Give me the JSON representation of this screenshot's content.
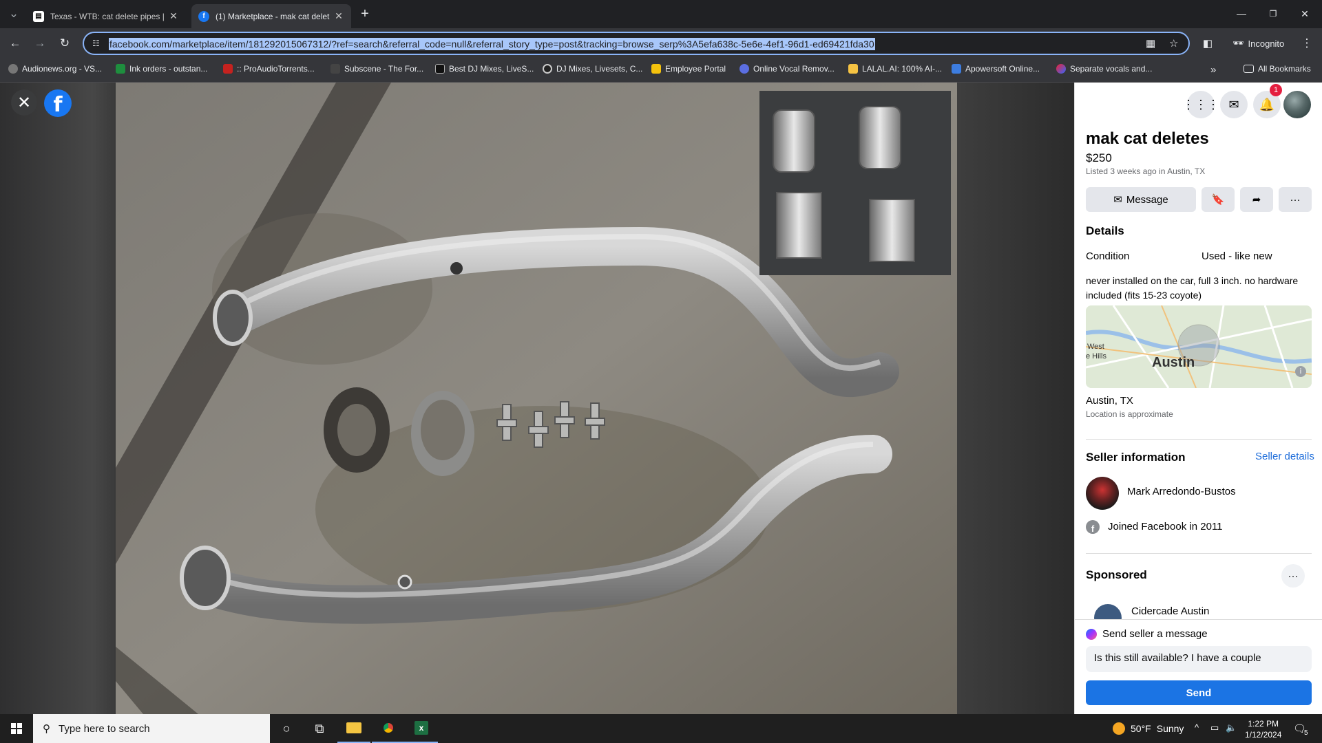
{
  "browser": {
    "tabs": [
      {
        "title": "Texas - WTB: cat delete pipes |",
        "favicon": "site-favicon-icon",
        "active": false
      },
      {
        "title": "(1) Marketplace - mak cat delet",
        "favicon": "facebook-icon",
        "active": true
      }
    ],
    "new_tab": "+",
    "url": "facebook.com/marketplace/item/181292015067312/?ref=search&referral_code=null&referral_story_type=post&tracking=browse_serp%3A5efa638c-5e6e-4ef1-96d1-ed69421fda30",
    "profile_label": "Incognito",
    "bookmarks": [
      "Audionews.org - VS...",
      "Ink orders - outstan...",
      ":: ProAudioTorrents...",
      "Subscene - The For...",
      "Best DJ Mixes, LiveS...",
      "DJ Mixes, Livesets, C...",
      "Employee Portal",
      "Online Vocal Remov...",
      "LALAL.AI: 100% AI-...",
      "Apowersoft Online...",
      "Separate vocals and..."
    ],
    "bookmarks_more": "»",
    "all_bookmarks": "All Bookmarks"
  },
  "listing": {
    "title": "mak cat deletes",
    "price": "$250",
    "listed": "Listed 3 weeks ago in Austin, TX",
    "message_button": "Message",
    "details_heading": "Details",
    "condition_label": "Condition",
    "condition_value": "Used - like new",
    "description": "never installed on the car, full 3 inch. no hardware included (fits 15-23 coyote)",
    "map": {
      "west_label": "West",
      "hills_label": "e Hills",
      "city_label": "Austin",
      "info": "i"
    },
    "location": "Austin, TX",
    "location_note": "Location is approximate"
  },
  "seller": {
    "heading": "Seller information",
    "details_link": "Seller details",
    "name": "Mark Arredondo-Bustos",
    "joined": "Joined Facebook in 2011"
  },
  "sponsored": {
    "heading": "Sponsored",
    "more": "···",
    "advertiser": "Cidercade Austin"
  },
  "message": {
    "heading": "Send seller a message",
    "draft": "Is this still available? I have a couple",
    "send": "Send"
  },
  "header": {
    "notification_count": "1"
  },
  "taskbar": {
    "search_placeholder": "Type here to search",
    "temperature": "50°F",
    "condition": "Sunny",
    "time": "1:22 PM",
    "date": "1/12/2024",
    "action_center_count": "5"
  },
  "colors": {
    "facebook_blue": "#1877f2",
    "send_blue": "#1b74e4",
    "link_blue": "#216fdb",
    "badge_red": "#e41e3f"
  }
}
